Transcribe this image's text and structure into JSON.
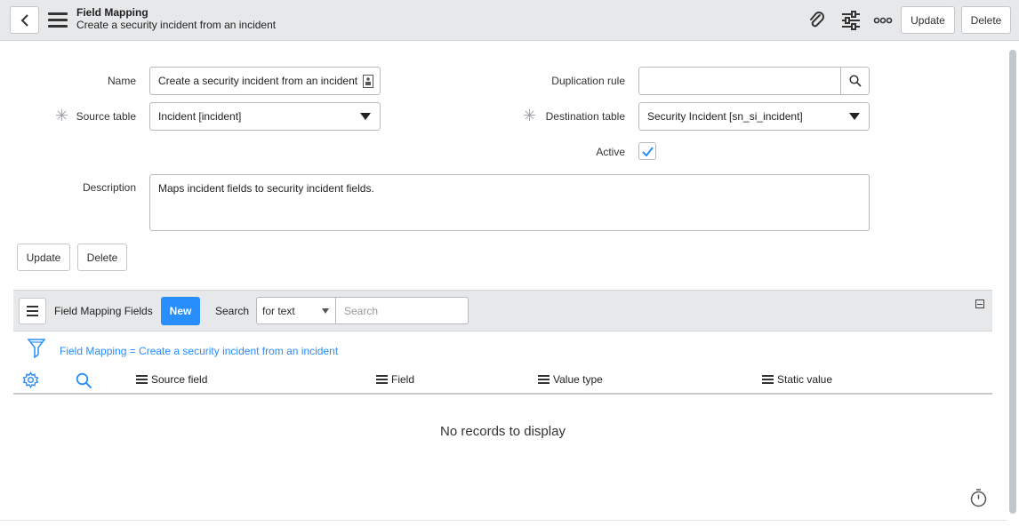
{
  "header": {
    "title": "Field Mapping",
    "subtitle": "Create a security incident from an incident",
    "update_label": "Update",
    "delete_label": "Delete",
    "icons": [
      "back-icon",
      "menu-icon",
      "paperclip-icon",
      "settings-sliders-icon",
      "more-icon"
    ]
  },
  "form": {
    "name_label": "Name",
    "name_value": "Create a security incident from an incident",
    "duplication_label": "Duplication rule",
    "duplication_value": "",
    "source_table_label": "Source table",
    "source_table_value": "Incident [incident]",
    "destination_table_label": "Destination table",
    "destination_table_value": "Security Incident [sn_si_incident]",
    "active_label": "Active",
    "active_checked": true,
    "description_label": "Description",
    "description_value": "Maps incident fields to security incident fields.",
    "update_label": "Update",
    "delete_label": "Delete"
  },
  "related_list": {
    "title": "Field Mapping Fields",
    "new_label": "New",
    "search_label": "Search",
    "search_mode": "for text",
    "search_placeholder": "Search",
    "filter_text": "Field Mapping = Create a security incident from an incident",
    "columns": [
      "Source field",
      "Field",
      "Value type",
      "Static value"
    ],
    "empty_text": "No records to display"
  },
  "colors": {
    "accent": "#278efc",
    "header_bg": "#e6e8ea"
  }
}
